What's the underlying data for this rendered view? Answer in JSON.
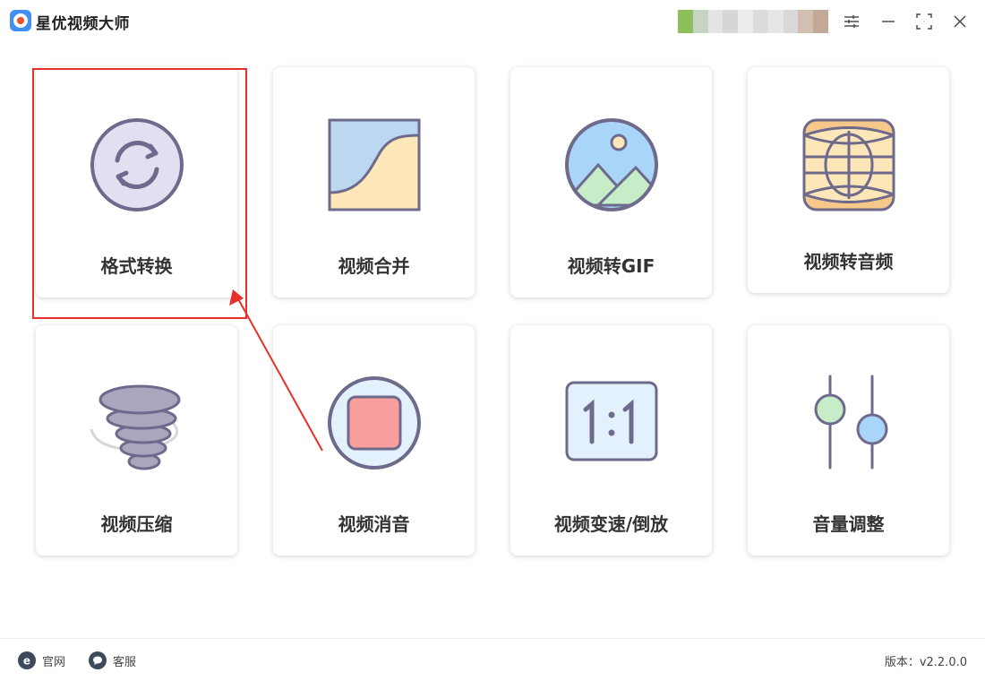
{
  "app": {
    "title": "星优视频大师",
    "logo_icon": "app-logo-icon"
  },
  "window_controls": {
    "settings_icon": "sliders-icon",
    "minimize_icon": "minimize-icon",
    "maximize_icon": "maximize-icon",
    "close_icon": "close-icon"
  },
  "tools": [
    {
      "label": "格式转换",
      "icon": "refresh-circle-icon",
      "selected": true
    },
    {
      "label": "视频合并",
      "icon": "merge-curve-icon"
    },
    {
      "label": "视频转GIF",
      "icon": "landscape-image-icon"
    },
    {
      "label": "视频转音频",
      "icon": "audio-globe-icon"
    },
    {
      "label": "视频压缩",
      "icon": "tornado-icon"
    },
    {
      "label": "视频消音",
      "icon": "stop-circle-icon"
    },
    {
      "label": "视频变速/倒放",
      "icon": "aspect-ratio-icon"
    },
    {
      "label": "音量调整",
      "icon": "volume-sliders-icon"
    }
  ],
  "footer": {
    "website": "官网",
    "support": "客服",
    "version": "版本：v2.2.0.0"
  },
  "colors": {
    "accent": "#e8302a",
    "icon_outline": "#6e6a8c"
  }
}
